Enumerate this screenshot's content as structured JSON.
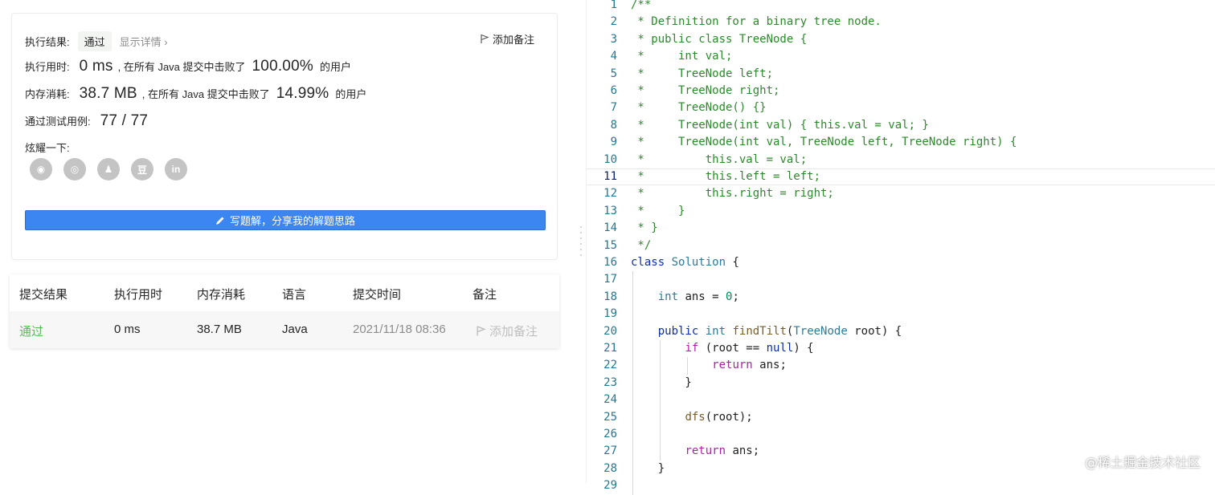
{
  "result": {
    "status_label": "执行结果:",
    "status_value": "通过",
    "detail_link": "显示详情 ›",
    "add_note": "添加备注",
    "runtime_label": "执行用时:",
    "runtime_value": "0 ms",
    "runtime_text": ", 在所有 Java 提交中击败了",
    "runtime_percent": "100.00%",
    "runtime_suffix": "的用户",
    "memory_label": "内存消耗:",
    "memory_value": "38.7 MB",
    "memory_text": ", 在所有 Java 提交中击败了",
    "memory_percent": "14.99%",
    "memory_suffix": "的用户",
    "tests_label": "通过测试用例:",
    "tests_value": "77 / 77",
    "share_label": "炫耀一下:",
    "share_icons": [
      {
        "name": "wechat-icon",
        "glyph": "◉"
      },
      {
        "name": "weibo-icon",
        "glyph": "◎"
      },
      {
        "name": "qq-icon",
        "glyph": "♟"
      },
      {
        "name": "douban-icon",
        "glyph": "豆"
      },
      {
        "name": "linkedin-icon",
        "glyph": "in"
      }
    ],
    "write_button": "写题解，分享我的解题思路"
  },
  "submissions": {
    "headers": [
      "提交结果",
      "执行用时",
      "内存消耗",
      "语言",
      "提交时间",
      "备注"
    ],
    "rows": [
      {
        "result": "通过",
        "runtime": "0 ms",
        "memory": "38.7 MB",
        "language": "Java",
        "time": "2021/11/18 08:36",
        "note": "添加备注"
      }
    ]
  },
  "editor": {
    "active_line": 11,
    "lines": [
      {
        "n": "1",
        "tokens": [
          [
            "com",
            "/**"
          ]
        ]
      },
      {
        "n": "2",
        "tokens": [
          [
            "com",
            " * Definition for a binary tree node."
          ]
        ]
      },
      {
        "n": "3",
        "tokens": [
          [
            "com",
            " * public class TreeNode {"
          ]
        ]
      },
      {
        "n": "4",
        "tokens": [
          [
            "com",
            " *     int val;"
          ]
        ]
      },
      {
        "n": "5",
        "tokens": [
          [
            "com",
            " *     TreeNode left;"
          ]
        ]
      },
      {
        "n": "6",
        "tokens": [
          [
            "com",
            " *     TreeNode right;"
          ]
        ]
      },
      {
        "n": "7",
        "tokens": [
          [
            "com",
            " *     TreeNode() {}"
          ]
        ]
      },
      {
        "n": "8",
        "tokens": [
          [
            "com",
            " *     TreeNode(int val) { this.val = val; }"
          ]
        ]
      },
      {
        "n": "9",
        "tokens": [
          [
            "com",
            " *     TreeNode(int val, TreeNode left, TreeNode right) {"
          ]
        ]
      },
      {
        "n": "10",
        "tokens": [
          [
            "com",
            " *         this.val = val;"
          ]
        ]
      },
      {
        "n": "11",
        "tokens": [
          [
            "com",
            " *         this.left = left;"
          ]
        ]
      },
      {
        "n": "12",
        "tokens": [
          [
            "com",
            " *         this.right = right;"
          ]
        ]
      },
      {
        "n": "13",
        "tokens": [
          [
            "com",
            " *     }"
          ]
        ]
      },
      {
        "n": "14",
        "tokens": [
          [
            "com",
            " * }"
          ]
        ]
      },
      {
        "n": "15",
        "tokens": [
          [
            "com",
            " */"
          ]
        ]
      },
      {
        "n": "16",
        "tokens": [
          [
            "kw",
            "class"
          ],
          [
            "pl",
            " "
          ],
          [
            "ty",
            "Solution"
          ],
          [
            "pl",
            " {"
          ]
        ]
      },
      {
        "n": "17",
        "tokens": []
      },
      {
        "n": "18",
        "tokens": [
          [
            "pl",
            "    "
          ],
          [
            "ty",
            "int"
          ],
          [
            "pl",
            " "
          ],
          [
            "var",
            "ans"
          ],
          [
            "pl",
            " = "
          ],
          [
            "num",
            "0"
          ],
          [
            "pl",
            ";"
          ]
        ]
      },
      {
        "n": "19",
        "tokens": []
      },
      {
        "n": "20",
        "tokens": [
          [
            "pl",
            "    "
          ],
          [
            "kw",
            "public"
          ],
          [
            "pl",
            " "
          ],
          [
            "ty",
            "int"
          ],
          [
            "pl",
            " "
          ],
          [
            "fn",
            "findTilt"
          ],
          [
            "pl",
            "("
          ],
          [
            "ty",
            "TreeNode"
          ],
          [
            "pl",
            " "
          ],
          [
            "var",
            "root"
          ],
          [
            "pl",
            ") {"
          ]
        ]
      },
      {
        "n": "21",
        "tokens": [
          [
            "pl",
            "        "
          ],
          [
            "ctl",
            "if"
          ],
          [
            "pl",
            " (root == "
          ],
          [
            "kw",
            "null"
          ],
          [
            "pl",
            ") {"
          ]
        ]
      },
      {
        "n": "22",
        "tokens": [
          [
            "pl",
            "            "
          ],
          [
            "ctl",
            "return"
          ],
          [
            "pl",
            " ans;"
          ]
        ]
      },
      {
        "n": "23",
        "tokens": [
          [
            "pl",
            "        }"
          ]
        ]
      },
      {
        "n": "24",
        "tokens": []
      },
      {
        "n": "25",
        "tokens": [
          [
            "pl",
            "        "
          ],
          [
            "fn",
            "dfs"
          ],
          [
            "pl",
            "(root);"
          ]
        ]
      },
      {
        "n": "26",
        "tokens": []
      },
      {
        "n": "27",
        "tokens": [
          [
            "pl",
            "        "
          ],
          [
            "ctl",
            "return"
          ],
          [
            "pl",
            " ans;"
          ]
        ]
      },
      {
        "n": "28",
        "tokens": [
          [
            "pl",
            "    }"
          ]
        ]
      },
      {
        "n": "29",
        "tokens": []
      }
    ]
  },
  "watermark": "@稀土掘金技术社区",
  "colors": {
    "accent": "#3b86f1",
    "pass": "#5cb85c",
    "comment": "#2c8a2c",
    "keyword": "#0b2fa8",
    "type": "#2f7a9a",
    "control": "#a626a4"
  }
}
